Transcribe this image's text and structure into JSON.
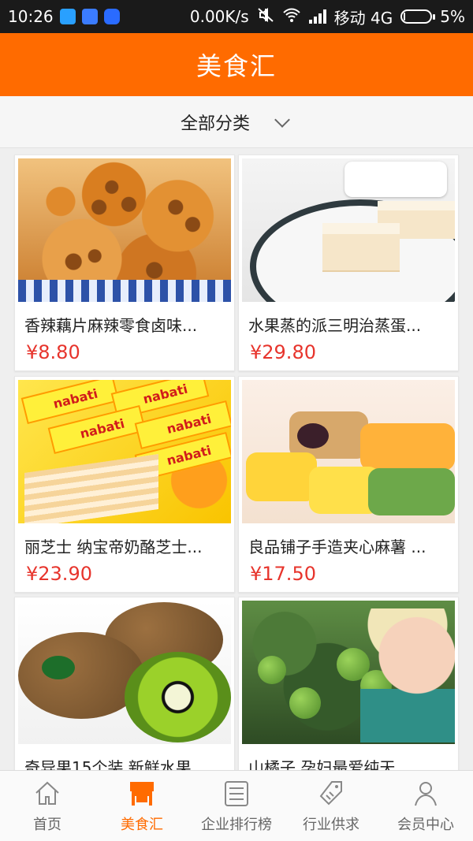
{
  "status_bar": {
    "time": "10:26",
    "network_speed": "0.00K/s",
    "carrier": "移动 4G",
    "battery": "5%",
    "battery_level": 0.05
  },
  "header": {
    "title": "美食汇"
  },
  "filter": {
    "label": "全部分类"
  },
  "products": [
    {
      "name": "香辣藕片麻辣零食卤味...",
      "price": "¥8.80"
    },
    {
      "name": "水果蒸的派三明治蒸蛋...",
      "price": "¥29.80"
    },
    {
      "name": "丽芝士 纳宝帝奶酪芝士...",
      "price": "¥23.90"
    },
    {
      "name": "良品铺子手造夹心麻薯 ...",
      "price": "¥17.50"
    },
    {
      "name": "奇异果15个装 新鲜水果...",
      "price": ""
    },
    {
      "name": "山橘子 孕妇最爱纯天...",
      "price": ""
    }
  ],
  "tabbar": {
    "items": [
      {
        "label": "首页",
        "icon": "home-icon"
      },
      {
        "label": "美食汇",
        "icon": "shop-icon",
        "active": true
      },
      {
        "label": "企业排行榜",
        "icon": "list-icon"
      },
      {
        "label": "行业供求",
        "icon": "tag-icon"
      },
      {
        "label": "会员中心",
        "icon": "user-icon"
      }
    ],
    "active_color": "#ff6b00"
  },
  "colors": {
    "brand": "#ff6b00",
    "price": "#e7342c"
  }
}
